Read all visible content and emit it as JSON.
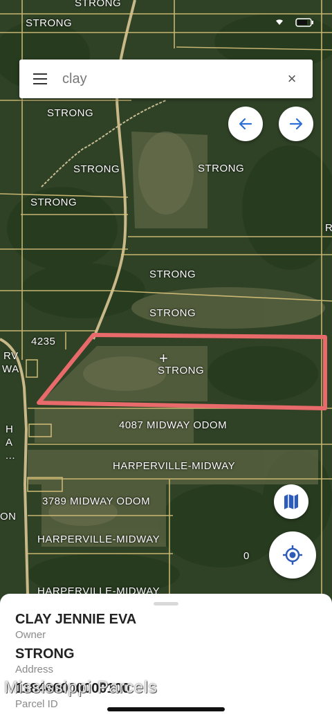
{
  "status_bar": {
    "top_label": "STRONG"
  },
  "search": {
    "value": "clay",
    "clear_symbol": "×"
  },
  "nav": {
    "back_symbol": "←",
    "forward_symbol": "→"
  },
  "map": {
    "parcel_labels": [
      "STRONG",
      "STRONG",
      "STRONG",
      "STRONG",
      "STRONG",
      "STRONG",
      "STRONG",
      "STRONG",
      "STRONG",
      "STRONG",
      "4235",
      "RV",
      "WA",
      "4087 MIDWAY ODOM",
      "HARPERVILLE-MIDWAY",
      "3789 MIDWAY ODOM",
      "HARPERVILLE-MIDWAY",
      "HARPERVILLE-MIDWAY",
      "H",
      "A",
      "...",
      "ON",
      "0",
      "R"
    ],
    "highlight_color": "#e86a6a",
    "boundary_color": "#d8c27a",
    "center_marker": "+"
  },
  "buttons": {
    "layers_icon": "map-icon",
    "locate_icon": "crosshair-icon"
  },
  "details": {
    "owner_value": "CLAY JENNIE EVA",
    "owner_label": "Owner",
    "address_value": "STRONG",
    "address_label": "Address",
    "parcel_value": "118400000000100",
    "parcel_label": "Parcel ID"
  },
  "watermark": "Mississippi Parcels"
}
